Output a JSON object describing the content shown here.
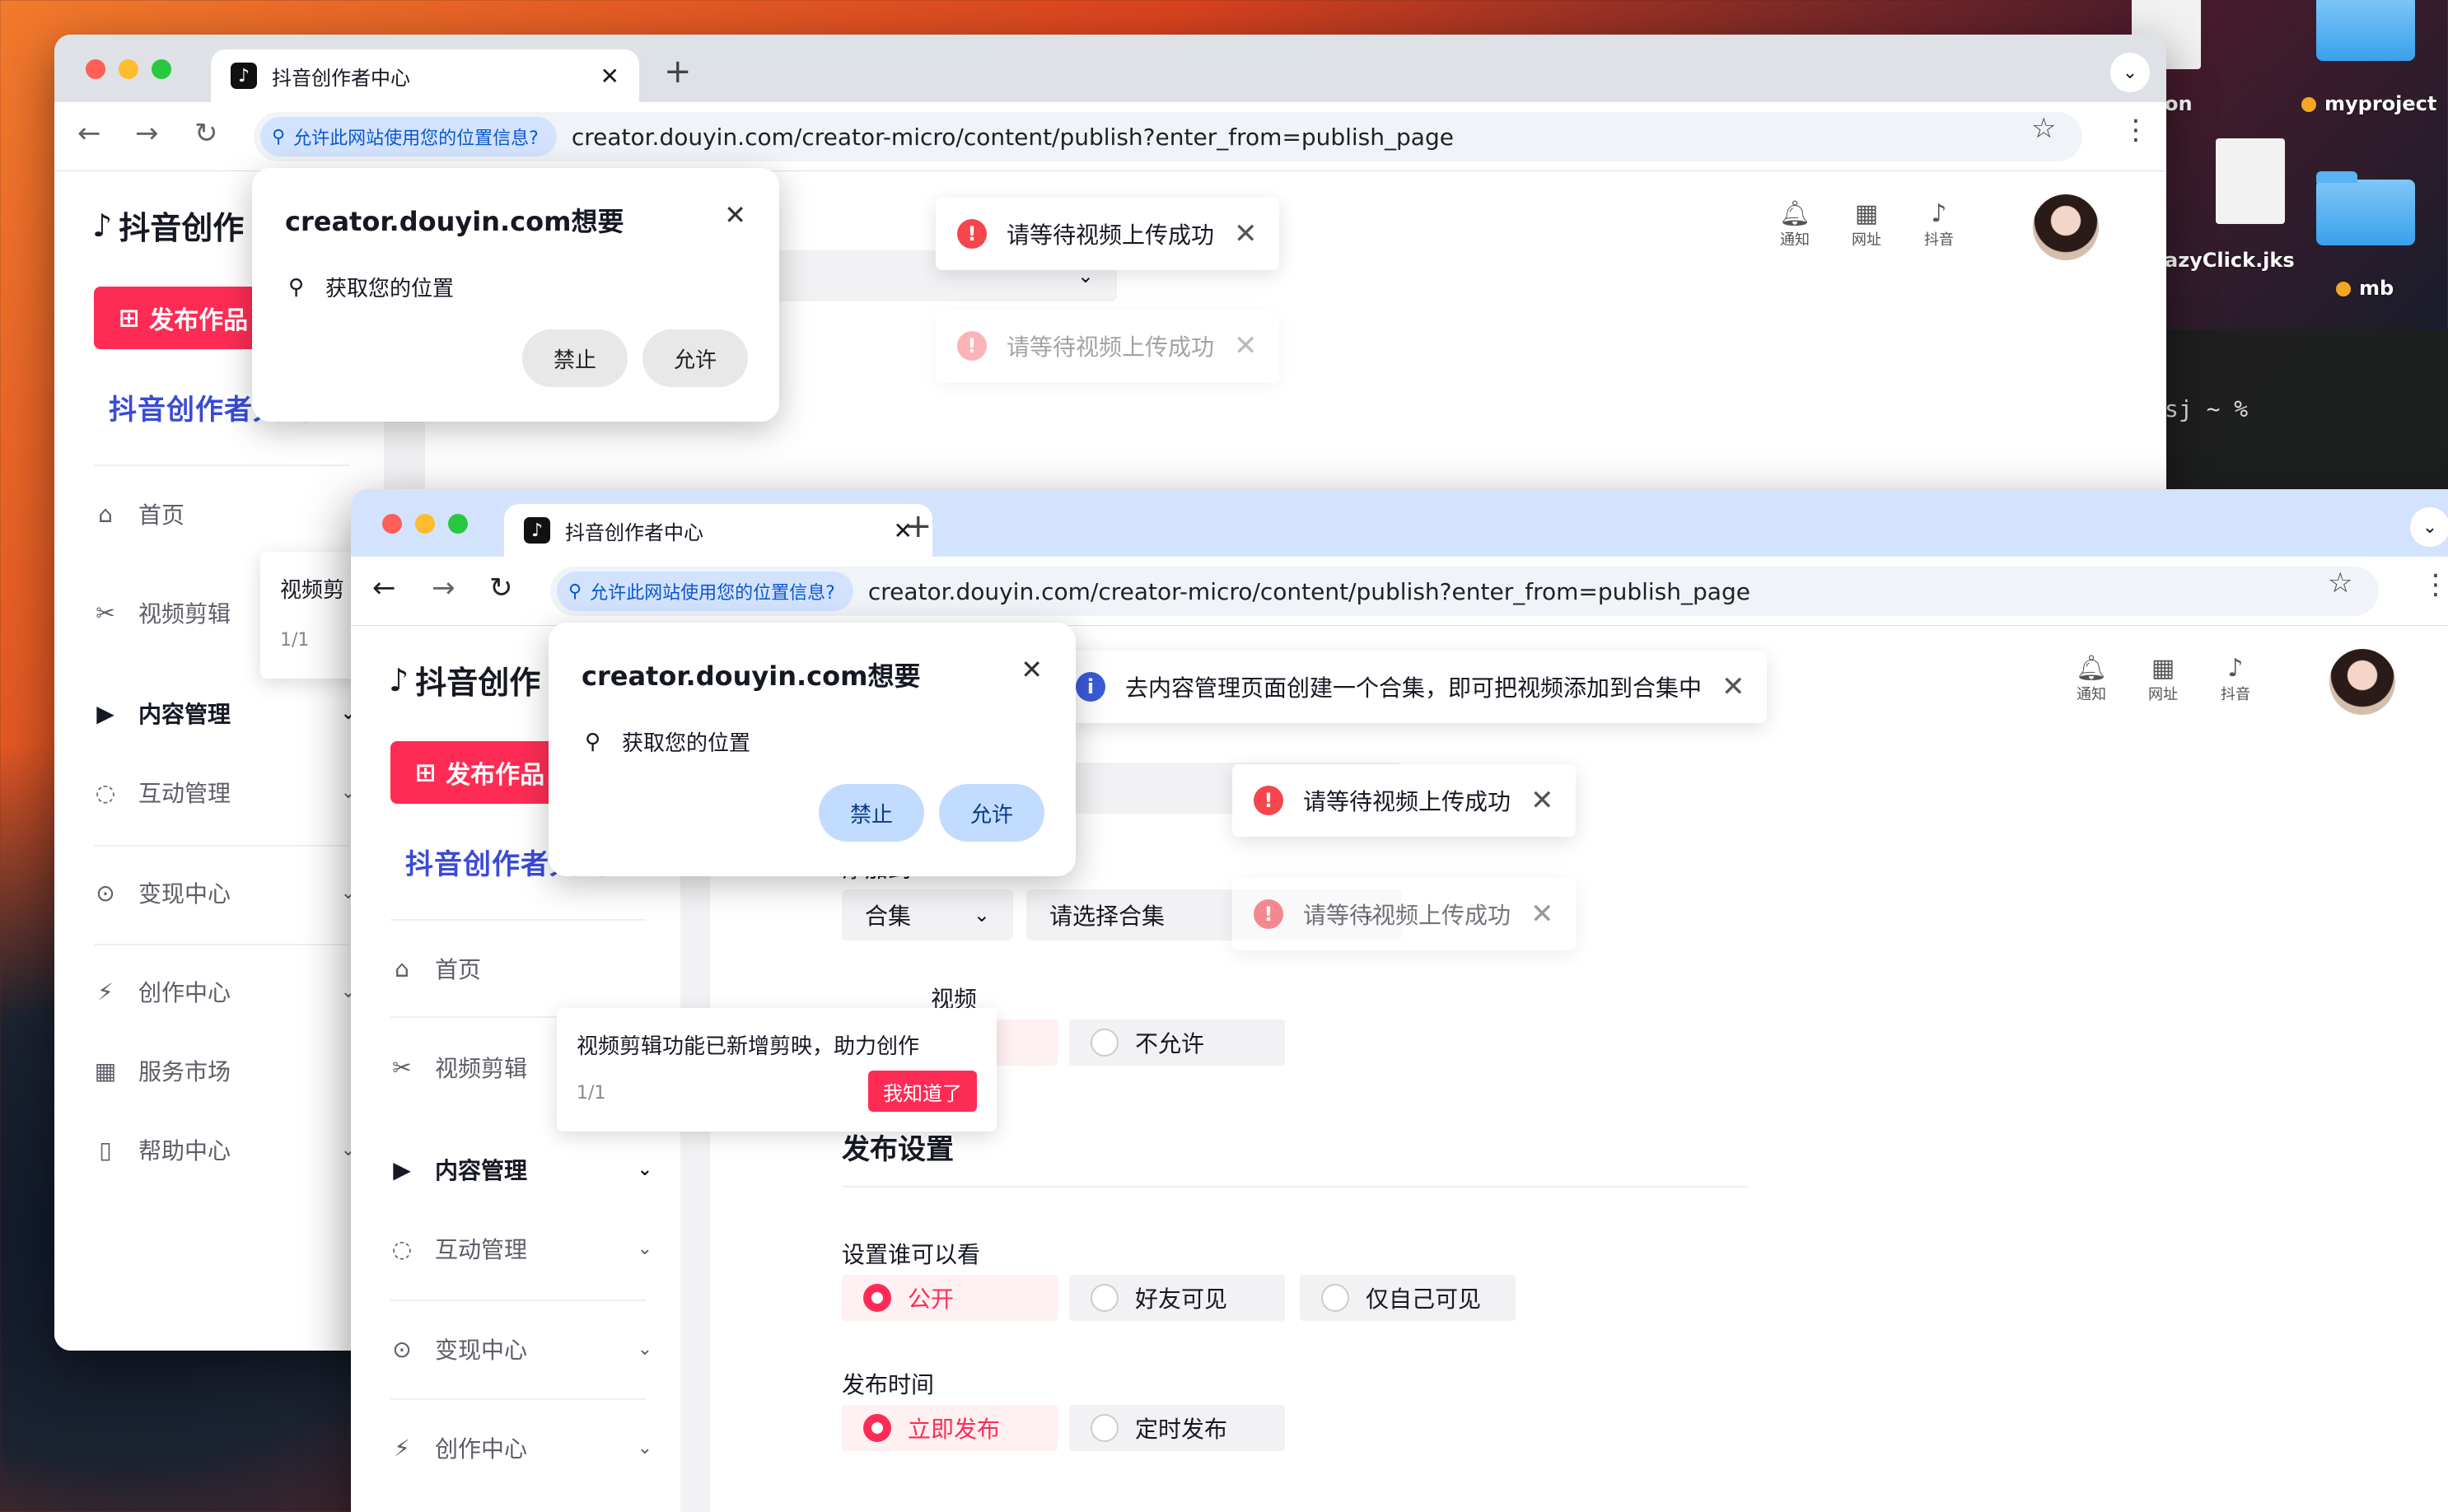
{
  "desktop": {
    "items": [
      {
        "label": "on"
      },
      {
        "label": "myproject"
      },
      {
        "label": "azyClick.jks"
      },
      {
        "label": "mb"
      }
    ],
    "terminal_text": "sj ~ %"
  },
  "browser": {
    "tab_title": "抖音创作者中心",
    "permission_chip": "允许此网站使用您的位置信息?",
    "url": "creator.douyin.com/creator-micro/content/publish?enter_from=publish_page"
  },
  "popup": {
    "title": "creator.douyin.com想要",
    "location_text": "获取您的位置",
    "deny_label": "禁止",
    "allow_label": "允许"
  },
  "sidebar": {
    "logo_text": "抖音创作",
    "publish_button": "发布作品",
    "conference": "抖音创作者大会",
    "items": [
      {
        "label": "首页",
        "icon": "home-icon"
      },
      {
        "label": "视频剪辑",
        "icon": "scissors-icon"
      },
      {
        "label": "内容管理",
        "icon": "play-square-icon"
      },
      {
        "label": "互动管理",
        "icon": "chat-icon"
      },
      {
        "label": "变现中心",
        "icon": "coin-icon"
      },
      {
        "label": "创作中心",
        "icon": "bolt-icon"
      },
      {
        "label": "服务市场",
        "icon": "shop-icon"
      },
      {
        "label": "帮助中心",
        "icon": "book-icon"
      }
    ]
  },
  "header": {
    "notify": "通知",
    "site": "网址",
    "douyin": "抖音"
  },
  "toasts": {
    "upload_wait": "请等待视频上传成功",
    "collection_tip": "去内容管理页面创建一个合集，即可把视频添加到合集中"
  },
  "tooltip": {
    "text": "视频剪辑功能已新增剪映，助力创作",
    "text_partial": "视频剪",
    "page": "1/1",
    "ok": "我知道了"
  },
  "form": {
    "add_to_label": "添加到",
    "collection_type": "合集",
    "collection_placeholder": "请选择合集",
    "video_label_tail": "视频",
    "not_allow": "不允许",
    "publish_settings": "发布设置",
    "visibility_label": "设置谁可以看",
    "visibility_options": [
      "公开",
      "好友可见",
      "仅自己可见"
    ],
    "time_label": "发布时间",
    "time_options": [
      "立即发布",
      "定时发布"
    ]
  },
  "colors": {
    "brand": "#fe2c55",
    "chip": "#d3e3fd"
  }
}
